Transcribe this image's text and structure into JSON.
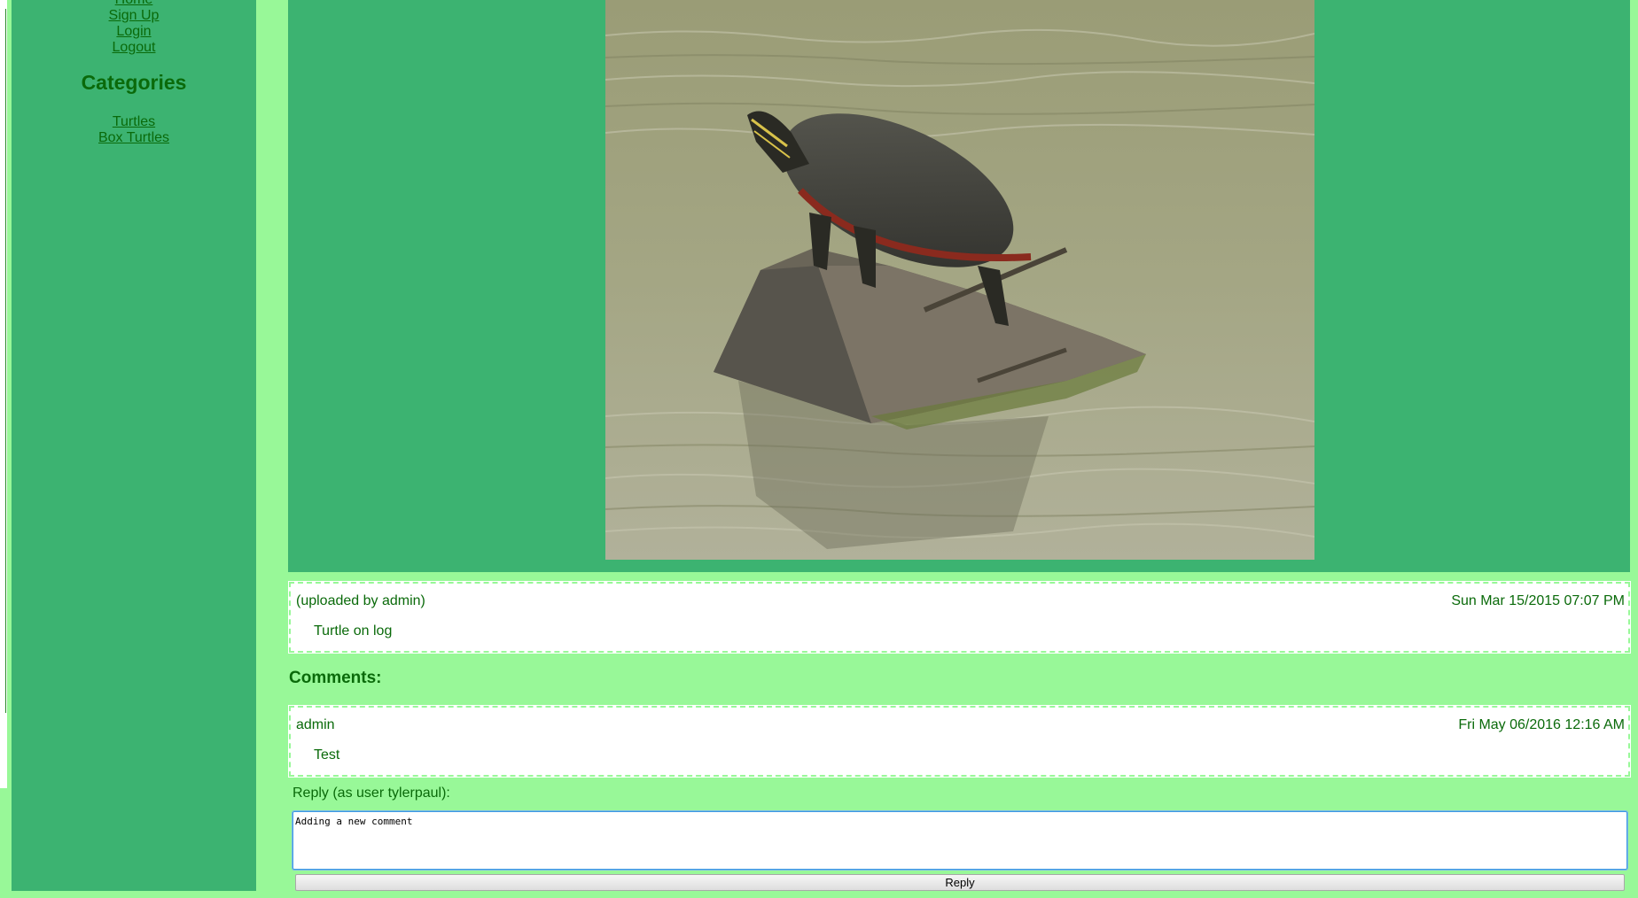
{
  "sidebar": {
    "nav": [
      "Home",
      "Sign Up",
      "Login",
      "Logout"
    ],
    "categories_title": "Categories",
    "categories": [
      "Turtles",
      "Box Turtles"
    ]
  },
  "post": {
    "uploader": "(uploaded by admin)",
    "date": "Sun Mar 15/2015 07:07 PM",
    "caption": "Turtle on log"
  },
  "comments": {
    "title": "Comments:",
    "items": [
      {
        "author": "admin",
        "date": "Fri May 06/2016 12:16 AM",
        "text": "Test"
      }
    ]
  },
  "reply": {
    "label": "Reply (as user tylerpaul):",
    "value": "Adding a new comment",
    "button": "Reply"
  },
  "colors": {
    "page_bg": "#98f898",
    "panel_bg": "#3cb371",
    "text": "#0a6a0a"
  }
}
